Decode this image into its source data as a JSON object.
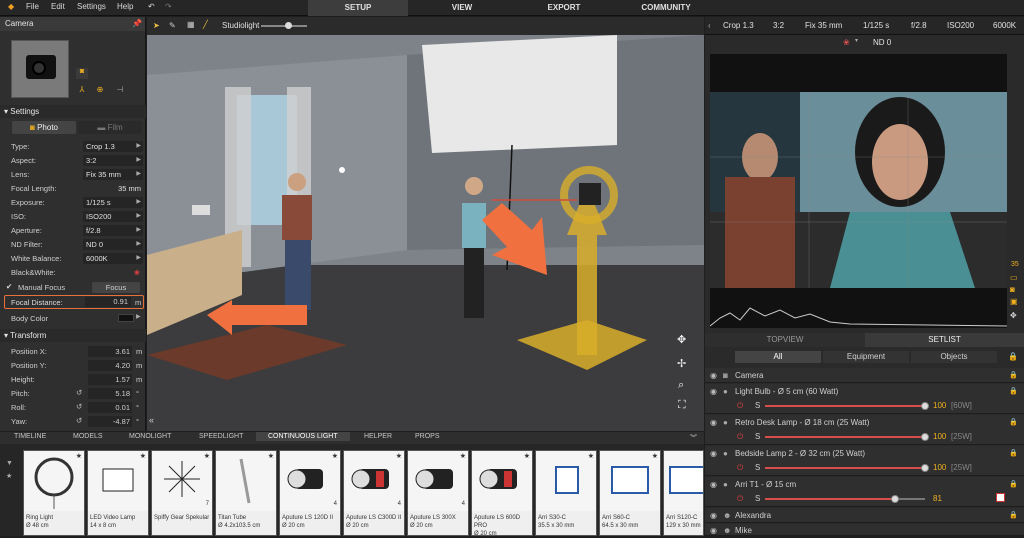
{
  "menu": {
    "file": "File",
    "edit": "Edit",
    "settings": "Settings",
    "help": "Help"
  },
  "tabs": {
    "setup": "SETUP",
    "view": "VIEW",
    "export": "EXPORT",
    "community": "COMMUNITY"
  },
  "left": {
    "title": "Camera",
    "settings_label": "Settings",
    "photo_label": "Photo",
    "film_label": "Film",
    "fields": [
      {
        "label": "Type:",
        "value": "Crop 1.3"
      },
      {
        "label": "Aspect:",
        "value": "3:2"
      },
      {
        "label": "Lens:",
        "value": "Fix 35 mm"
      },
      {
        "label": "Focal Length:",
        "value": "35 mm"
      },
      {
        "label": "Exposure:",
        "value": "1/125 s"
      },
      {
        "label": "ISO:",
        "value": "ISO200"
      },
      {
        "label": "Aperture:",
        "value": "f/2.8"
      },
      {
        "label": "ND Filter:",
        "value": "ND 0"
      },
      {
        "label": "White Balance:",
        "value": "6000K"
      }
    ],
    "bw_label": "Black&White:",
    "manual_focus_label": "Manual Focus",
    "focus_button": "Focus",
    "focal_distance_label": "Focal Distance:",
    "focal_distance_value": "0.91",
    "focal_distance_unit": "m",
    "body_color_label": "Body Color",
    "transform_label": "Transform",
    "transform": [
      {
        "label": "Position X:",
        "value": "3.61",
        "unit": "m"
      },
      {
        "label": "Position Y:",
        "value": "4.20",
        "unit": "m"
      },
      {
        "label": "Height:",
        "value": "1.57",
        "unit": "m"
      },
      {
        "label": "Pitch:",
        "value": "5.18",
        "unit": "°"
      },
      {
        "label": "Roll:",
        "value": "0.01",
        "unit": "°"
      },
      {
        "label": "Yaw:",
        "value": "-4.87",
        "unit": "°"
      }
    ]
  },
  "viewport": {
    "preset": "Studiolight"
  },
  "right": {
    "crop": "Crop 1.3",
    "aspect": "3:2",
    "lens": "Fix 35 mm",
    "exposure": "1/125 s",
    "aperture": "f/2.8",
    "iso": "ISO200",
    "wb": "6000K",
    "nd": "ND 0",
    "side_value": "35",
    "tab_topview": "TOPVIEW",
    "tab_setlist": "SETLIST",
    "filter_all": "All",
    "filter_equipment": "Equipment",
    "filter_objects": "Objects",
    "items": [
      {
        "name": "Camera"
      },
      {
        "name": "Light Bulb - Ø 5 cm (60 Watt)",
        "s": "S",
        "pct": "100",
        "watt": "[60W]"
      },
      {
        "name": "Retro Desk Lamp - Ø 18 cm (25 Watt)",
        "s": "S",
        "pct": "100",
        "watt": "[25W]"
      },
      {
        "name": "Bedside Lamp 2 - Ø 32 cm (25 Watt)",
        "s": "S",
        "pct": "100",
        "watt": "[25W]"
      },
      {
        "name": "Arri T1 - Ø 15 cm",
        "s": "S",
        "pct": "81",
        "watt": ""
      },
      {
        "name": "Alexandra"
      },
      {
        "name": "Mike"
      }
    ]
  },
  "bottom": {
    "tabs": [
      "TIMELINE",
      "MODELS",
      "MONOLIGHT",
      "SPEEDLIGHT",
      "CONTINUOUS LIGHT",
      "HELPER",
      "PROPS"
    ],
    "cards": [
      {
        "name": "Ring Light",
        "size": "Ø 48 cm",
        "count": ""
      },
      {
        "name": "LED Video Lamp",
        "size": "14 x 8 cm",
        "count": ""
      },
      {
        "name": "Spiffy Gear Spekular",
        "size": "",
        "count": "7"
      },
      {
        "name": "Titan Tube",
        "size": "Ø 4.2x103.5 cm",
        "count": ""
      },
      {
        "name": "Aputure LS 120D II",
        "size": "Ø 20 cm",
        "count": "4"
      },
      {
        "name": "Aputure LS C300D II",
        "size": "Ø 20 cm",
        "count": "4"
      },
      {
        "name": "Aputure LS 300X",
        "size": "Ø 20 cm",
        "count": "4"
      },
      {
        "name": "Aputure LS 600D PRO",
        "size": "Ø 20 cm",
        "count": ""
      },
      {
        "name": "Arri S30-C",
        "size": "35.5 x 30 mm",
        "count": ""
      },
      {
        "name": "Arri S60-C",
        "size": "64.5 x 30 mm",
        "count": ""
      },
      {
        "name": "Arri S120-C",
        "size": "129 x 30 mm",
        "count": ""
      }
    ]
  }
}
